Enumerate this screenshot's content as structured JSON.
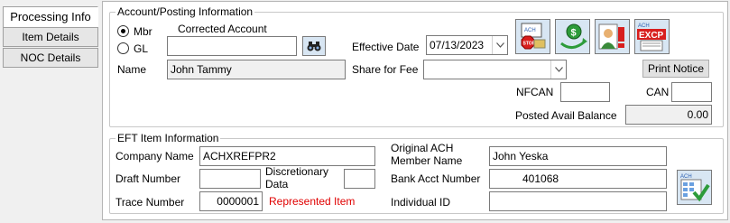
{
  "tabs": {
    "processing_info": "Processing Info",
    "item_details": "Item Details",
    "noc_details": "NOC Details"
  },
  "account_posting": {
    "title": "Account/Posting Information",
    "mbr_label": "Mbr",
    "gl_label": "GL",
    "selected_type": "Mbr",
    "corrected_account_label": "Corrected Account",
    "corrected_account_value": "",
    "name_label": "Name",
    "name_value": "John Tammy",
    "effective_date_label": "Effective Date",
    "effective_date_value": "07/13/2023",
    "share_for_fee_label": "Share for Fee",
    "share_for_fee_value": "",
    "print_notice_label": "Print Notice",
    "nfcan_label": "NFCAN",
    "nfcan_value": "",
    "can_label": "CAN",
    "can_value": "",
    "posted_avail_balance_label": "Posted Avail Balance",
    "posted_avail_balance_value": "0.00",
    "icon_buttons": [
      "ach-stop-icon",
      "money-transfer-icon",
      "person-alert-icon",
      "ach-exception-icon"
    ]
  },
  "eft_item": {
    "title": "EFT Item Information",
    "company_name_label": "Company Name",
    "company_name_value": "ACHXREFPR2",
    "draft_number_label": "Draft Number",
    "draft_number_value": "",
    "discretionary_data_label_1": "Discretionary",
    "discretionary_data_label_2": "Data",
    "discretionary_data_value": "",
    "trace_number_label": "Trace Number",
    "trace_number_value": "0000001",
    "represented_item_text": "Represented Item",
    "original_member_label_1": "Original ACH",
    "original_member_label_2": "Member Name",
    "original_member_value": "John Yeska",
    "bank_acct_label": "Bank Acct Number",
    "bank_acct_value": "401068",
    "individual_id_label": "Individual ID",
    "individual_id_value": ""
  },
  "colors": {
    "represented_item": "#e00000",
    "icon_button_bg": "#d8e6f3"
  }
}
